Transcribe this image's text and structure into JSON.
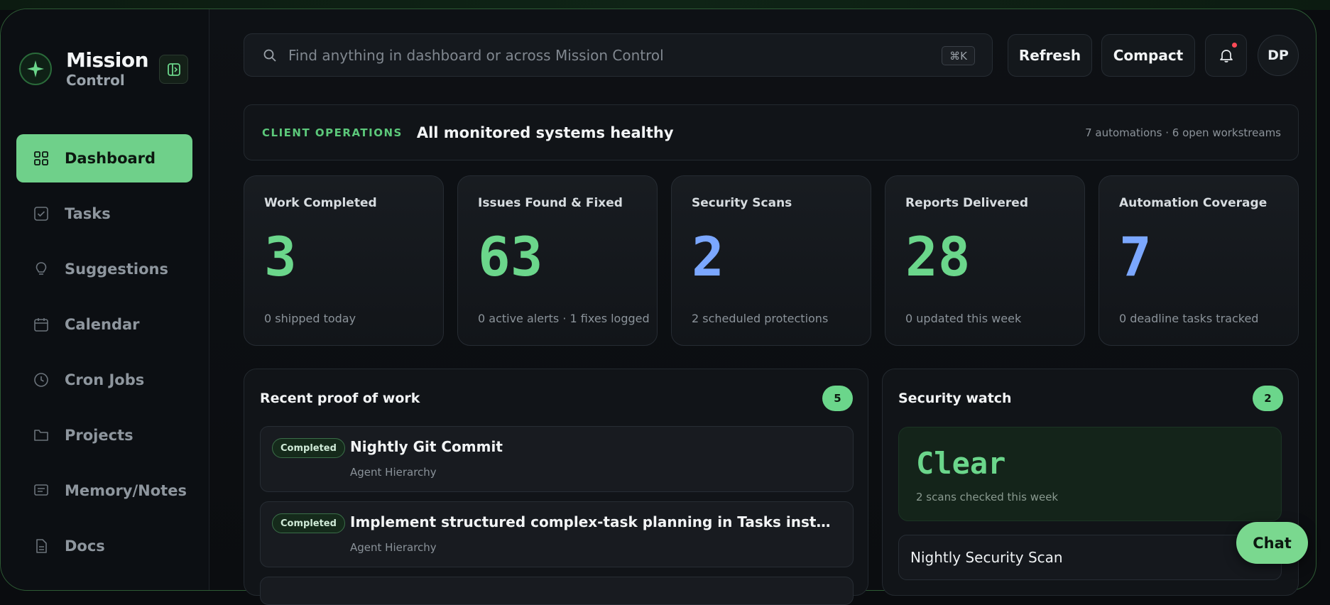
{
  "brand": {
    "title": "Mission",
    "subtitle": "Control",
    "logo_icon": "sparkle-icon",
    "collapse_icon": "sidebar-collapse-icon"
  },
  "nav": [
    {
      "label": "Dashboard",
      "icon": "grid-icon",
      "active": true
    },
    {
      "label": "Tasks",
      "icon": "checkbox-icon"
    },
    {
      "label": "Suggestions",
      "icon": "lightbulb-icon"
    },
    {
      "label": "Calendar",
      "icon": "calendar-icon"
    },
    {
      "label": "Cron Jobs",
      "icon": "clock-icon"
    },
    {
      "label": "Projects",
      "icon": "folder-icon"
    },
    {
      "label": "Memory/Notes",
      "icon": "notes-icon"
    },
    {
      "label": "Docs",
      "icon": "document-icon"
    }
  ],
  "search": {
    "placeholder": "Find anything in dashboard or across Mission Control",
    "shortcut": "⌘K"
  },
  "toolbar": {
    "refresh": "Refresh",
    "compact": "Compact",
    "avatar": "DP"
  },
  "banner": {
    "eyebrow": "CLIENT OPERATIONS",
    "title": "All monitored systems healthy",
    "meta": "7 automations · 6 open workstreams"
  },
  "stats": [
    {
      "label": "Work Completed",
      "value": "3",
      "sub": "0 shipped today",
      "color": "#6bd68b"
    },
    {
      "label": "Issues Found & Fixed",
      "value": "63",
      "sub": "0 active alerts · 1 fixes logged",
      "color": "#6bd68b"
    },
    {
      "label": "Security Scans",
      "value": "2",
      "sub": "2 scheduled protections",
      "color": "#7ba7ff"
    },
    {
      "label": "Reports Delivered",
      "value": "28",
      "sub": "0 updated this week",
      "color": "#6bd68b"
    },
    {
      "label": "Automation Coverage",
      "value": "7",
      "sub": "0 deadline tasks tracked",
      "color": "#7ba7ff"
    }
  ],
  "proof": {
    "title": "Recent proof of work",
    "count": "5",
    "items": [
      {
        "badge": "Completed",
        "title": "Nightly Git Commit",
        "sub": "Agent Hierarchy"
      },
      {
        "badge": "Completed",
        "title": "Implement structured complex-task planning in Tasks instead of Not…",
        "sub": "Agent Hierarchy"
      }
    ]
  },
  "security": {
    "title": "Security watch",
    "count": "2",
    "status": "Clear",
    "status_sub": "2 scans checked this week",
    "items": [
      {
        "title": "Nightly Security Scan"
      }
    ]
  },
  "chat": {
    "label": "Chat"
  },
  "colors": {
    "accent": "#6bd68b",
    "blue": "#7ba7ff",
    "alert": "#ff4a57"
  }
}
